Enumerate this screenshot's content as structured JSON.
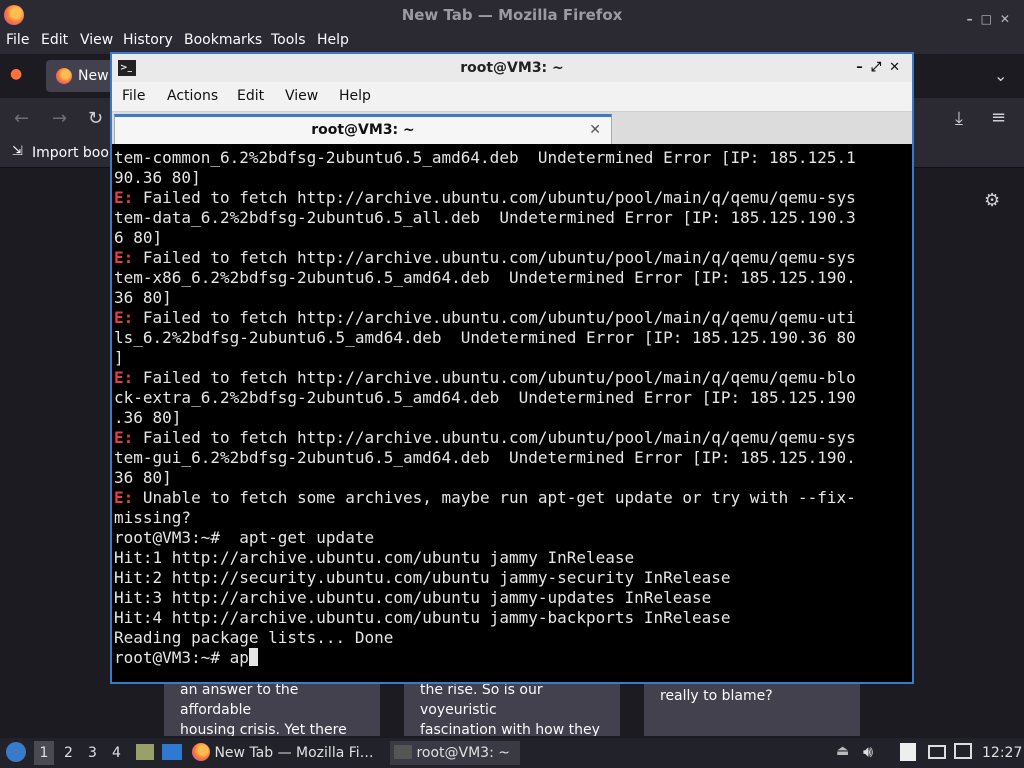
{
  "firefox": {
    "window_title": "New Tab — Mozilla Firefox",
    "menu": [
      "File",
      "Edit",
      "View",
      "History",
      "Bookmarks",
      "Tools",
      "Help"
    ],
    "tab_label": "New",
    "bookmark_import": "Import book",
    "cards": [
      {
        "lines": [
          "an answer to the affordable",
          "housing crisis. Yet there ar…"
        ]
      },
      {
        "lines": [
          "the rise. So is our voyeuristic",
          "fascination with how they …"
        ]
      },
      {
        "lines": [
          "really to blame?"
        ]
      }
    ]
  },
  "terminal": {
    "window_title": "root@VM3: ~",
    "menu": [
      "File",
      "Actions",
      "Edit",
      "View",
      "Help"
    ],
    "tab_label": "root@VM3: ~",
    "lines": [
      {
        "t": "tem-common_6.2%2bdfsg-2ubuntu6.5_amd64.deb  Undetermined Error [IP: 185.125.1"
      },
      {
        "t": "90.36 80]"
      },
      {
        "e": "E:",
        "t": " Failed to fetch http://archive.ubuntu.com/ubuntu/pool/main/q/qemu/qemu-sys"
      },
      {
        "t": "tem-data_6.2%2bdfsg-2ubuntu6.5_all.deb  Undetermined Error [IP: 185.125.190.3"
      },
      {
        "t": "6 80]"
      },
      {
        "e": "E:",
        "t": " Failed to fetch http://archive.ubuntu.com/ubuntu/pool/main/q/qemu/qemu-sys"
      },
      {
        "t": "tem-x86_6.2%2bdfsg-2ubuntu6.5_amd64.deb  Undetermined Error [IP: 185.125.190."
      },
      {
        "t": "36 80]"
      },
      {
        "e": "E:",
        "t": " Failed to fetch http://archive.ubuntu.com/ubuntu/pool/main/q/qemu/qemu-uti"
      },
      {
        "t": "ls_6.2%2bdfsg-2ubuntu6.5_amd64.deb  Undetermined Error [IP: 185.125.190.36 80"
      },
      {
        "t": "]"
      },
      {
        "e": "E:",
        "t": " Failed to fetch http://archive.ubuntu.com/ubuntu/pool/main/q/qemu/qemu-blo"
      },
      {
        "t": "ck-extra_6.2%2bdfsg-2ubuntu6.5_amd64.deb  Undetermined Error [IP: 185.125.190"
      },
      {
        "t": ".36 80]"
      },
      {
        "e": "E:",
        "t": " Failed to fetch http://archive.ubuntu.com/ubuntu/pool/main/q/qemu/qemu-sys"
      },
      {
        "t": "tem-gui_6.2%2bdfsg-2ubuntu6.5_amd64.deb  Undetermined Error [IP: 185.125.190."
      },
      {
        "t": "36 80]"
      },
      {
        "e": "E:",
        "t": " Unable to fetch some archives, maybe run apt-get update or try with --fix-"
      },
      {
        "t": "missing?"
      },
      {
        "t": "root@VM3:~#  apt-get update"
      },
      {
        "t": "Hit:1 http://archive.ubuntu.com/ubuntu jammy InRelease"
      },
      {
        "t": "Hit:2 http://security.ubuntu.com/ubuntu jammy-security InRelease"
      },
      {
        "t": "Hit:3 http://archive.ubuntu.com/ubuntu jammy-updates InRelease"
      },
      {
        "t": "Hit:4 http://archive.ubuntu.com/ubuntu jammy-backports InRelease"
      },
      {
        "t": "Reading package lists... Done"
      }
    ],
    "prompt": "root@VM3:~# ap"
  },
  "taskbar": {
    "workspaces": [
      "1",
      "2",
      "3",
      "4"
    ],
    "tasks": [
      "New Tab — Mozilla Fi…",
      "root@VM3: ~"
    ],
    "clock": "12:27"
  },
  "colors": {
    "terminal_error": "#e04040",
    "accent": "#3a7ac8"
  }
}
